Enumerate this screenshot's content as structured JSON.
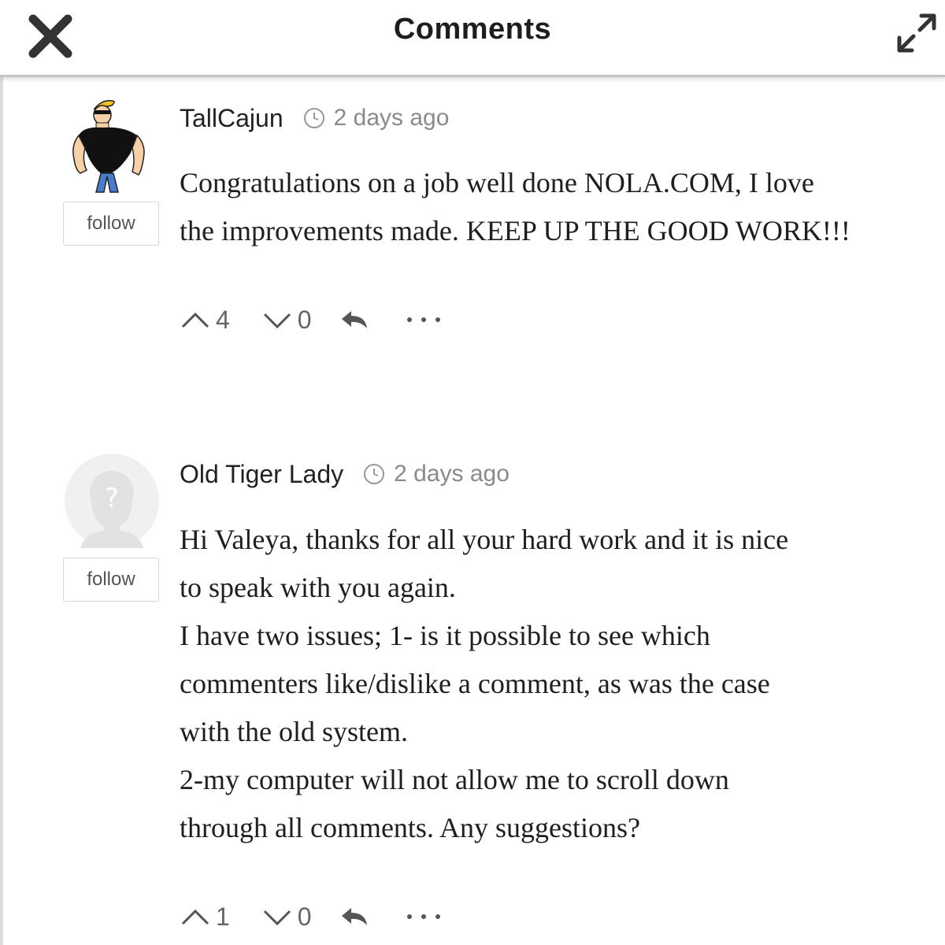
{
  "header": {
    "title": "Comments",
    "close_icon": "close-icon",
    "expand_icon": "expand-icon"
  },
  "comments": [
    {
      "author": "TallCajun",
      "time": "2 days ago",
      "avatar_icon": "cartoon-avatar",
      "follow_label": "follow",
      "body": [
        "Congratulations on a job well done NOLA.COM, I love",
        "the improvements made. KEEP UP THE GOOD WORK!!!"
      ],
      "upvotes": "4",
      "downvotes": "0"
    },
    {
      "author": "Old Tiger Lady",
      "time": "2 days ago",
      "avatar_icon": "default-avatar",
      "follow_label": "follow",
      "body": [
        "Hi Valeya, thanks for all your hard work and it is nice",
        "to speak with you again.",
        "I have two issues; 1- is it possible to see which",
        "commenters like/dislike a comment, as was the case",
        "with the old system.",
        "2-my computer will not allow me to scroll down",
        "through all comments. Any suggestions?"
      ],
      "upvotes": "1",
      "downvotes": "0"
    }
  ],
  "colors": {
    "text": "#1e1e1e",
    "muted": "#8a8a8a",
    "icon": "#555555",
    "border": "#d8d8d8"
  }
}
